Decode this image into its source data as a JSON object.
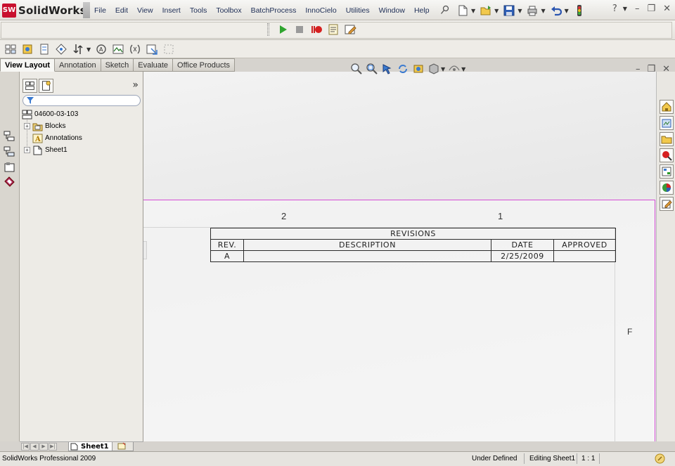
{
  "app": {
    "brand": "SolidWorks",
    "brand_mark": "SW",
    "menus": [
      "File",
      "Edit",
      "View",
      "Insert",
      "Tools",
      "Toolbox",
      "BatchProcess",
      "InnoCielo",
      "Utilities",
      "Window",
      "Help"
    ],
    "help_label": "?"
  },
  "command_tabs": [
    "View Layout",
    "Annotation",
    "Sketch",
    "Evaluate",
    "Office Products"
  ],
  "feature_tree": {
    "root": "04600-03-103",
    "items": [
      "Blocks",
      "Annotations",
      "Sheet1"
    ],
    "more_label": "»"
  },
  "drawing": {
    "zone_labels": [
      "2",
      "1"
    ],
    "row_label": "F",
    "revisions": {
      "title": "REVISIONS",
      "headers": [
        "REV.",
        "DESCRIPTION",
        "DATE",
        "APPROVED"
      ],
      "rows": [
        [
          "A",
          "",
          "2/25/2009",
          ""
        ]
      ]
    }
  },
  "sheet_tabs": {
    "active": "Sheet1"
  },
  "status_bar": {
    "product": "SolidWorks Professional 2009",
    "state": "Under Defined",
    "editing": "Editing Sheet1",
    "scale": "1 : 1"
  },
  "colors": {
    "sheet_border": "#d54dd5",
    "brand_red": "#c8102e"
  }
}
